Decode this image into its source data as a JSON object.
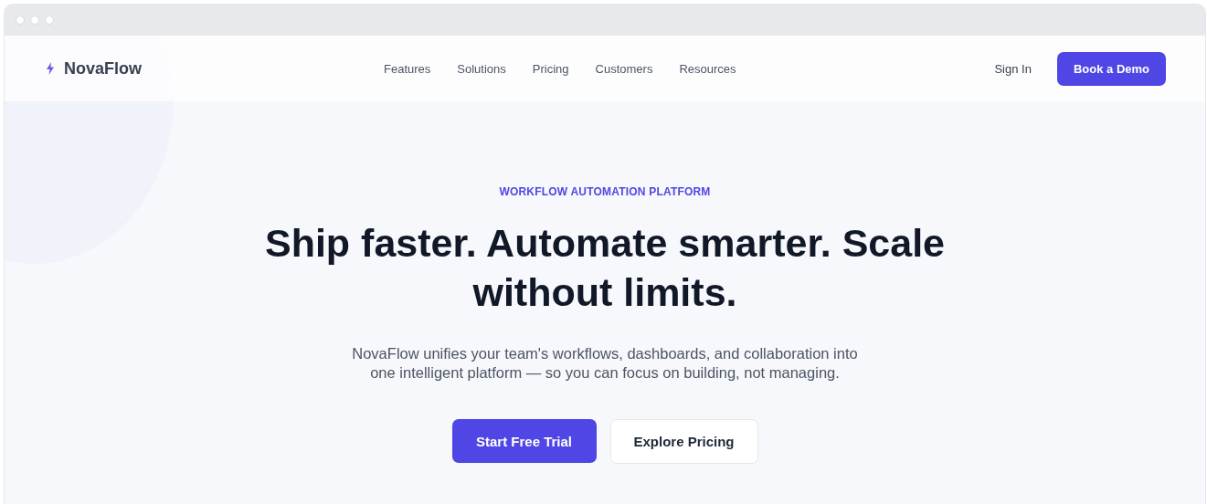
{
  "brand": {
    "name": "NovaFlow"
  },
  "nav": {
    "links": [
      "Features",
      "Solutions",
      "Pricing",
      "Customers",
      "Resources"
    ],
    "sign_in": "Sign In",
    "cta": "Book a Demo"
  },
  "hero": {
    "eyebrow": "WORKFLOW AUTOMATION PLATFORM",
    "headline": "Ship faster. Automate smarter. Scale without limits.",
    "subtitle": "NovaFlow unifies your team's workflows, dashboards, and collaboration into one intelligent platform — so you can focus on building, not managing.",
    "buttons": [
      {
        "label": "Start Free Trial",
        "kind": "primary"
      },
      {
        "label": "Explore Pricing",
        "kind": "secondary"
      }
    ]
  }
}
